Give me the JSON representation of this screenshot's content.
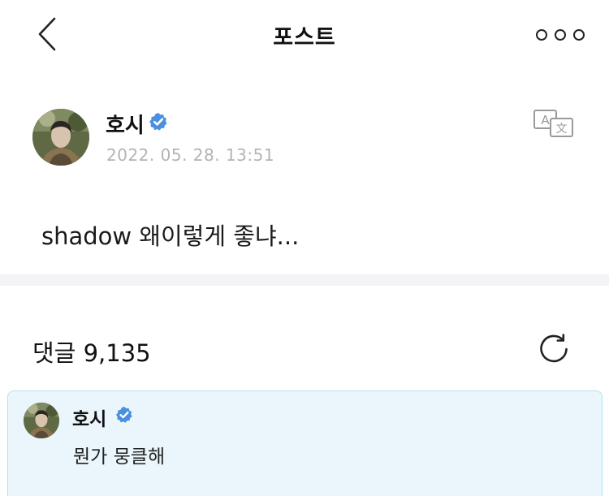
{
  "header": {
    "title": "포스트",
    "back_icon": "chevron-left-icon",
    "more_icon": "more-horizontal-icon"
  },
  "post": {
    "author": "호시",
    "verified": true,
    "timestamp": "2022. 05. 28. 13:51",
    "text": "shadow 왜이렇게 좋냐...",
    "translate_icon": "translate-icon"
  },
  "comments": {
    "label": "댓글",
    "count": "9,135",
    "refresh_icon": "refresh-icon",
    "items": [
      {
        "author": "호시",
        "verified": true,
        "text": "뭔가 뭉클해"
      }
    ]
  },
  "colors": {
    "verified_blue": "#4a90e2",
    "timestamp_gray": "#b4b4b4",
    "comment_highlight_bg": "#eaf6fb",
    "comment_highlight_border": "#b6e0ef",
    "divider": "#f4f4f6"
  }
}
